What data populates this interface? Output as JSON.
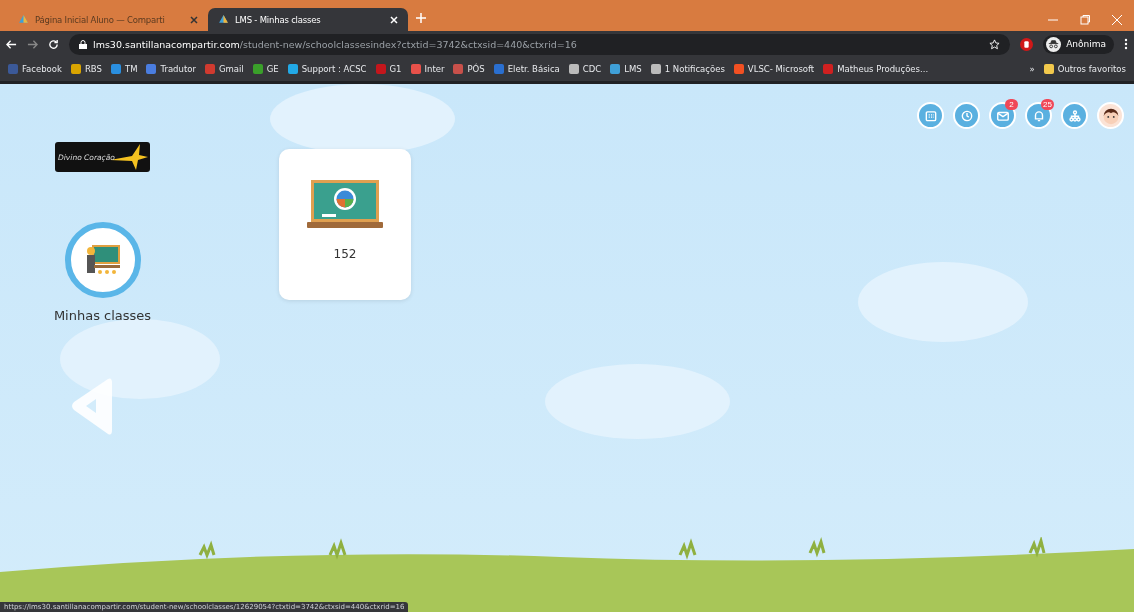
{
  "browser": {
    "tabs": [
      {
        "title": "Página Inicial Aluno — Comparti",
        "selected": false
      },
      {
        "title": "LMS - Minhas classes",
        "selected": true
      }
    ],
    "url_host": "lms30.santillanacompartir.com",
    "url_path": "/student-new/schoolclassesindex?ctxtid=3742&ctxsid=440&ctxrid=16",
    "profile": "Anônima",
    "bookmarks": [
      {
        "label": "Facebook",
        "color": "#3b5998"
      },
      {
        "label": "RBS",
        "color": "#d9a400"
      },
      {
        "label": "TM",
        "color": "#2a8fe0"
      },
      {
        "label": "Tradutor",
        "color": "#4a7de0"
      },
      {
        "label": "Gmail",
        "color": "#d03a2f"
      },
      {
        "label": "GE",
        "color": "#3aa02a"
      },
      {
        "label": "Support : ACSC",
        "color": "#22a9e6"
      },
      {
        "label": "G1",
        "color": "#c4161c"
      },
      {
        "label": "Inter",
        "color": "#e8514a"
      },
      {
        "label": "PÓS",
        "color": "#c8504a"
      },
      {
        "label": "Eletr. Básica",
        "color": "#2a6fd0"
      },
      {
        "label": "CDC",
        "color": "#bbbbbb"
      },
      {
        "label": "LMS",
        "color": "#3fa0d8"
      },
      {
        "label": "1 Notificações",
        "color": "#bbbbbb"
      },
      {
        "label": "VLSC- Microsoft",
        "color": "#f25022"
      },
      {
        "label": "Matheus Produções...",
        "color": "#d02020"
      }
    ],
    "overflow": "»",
    "other_bookmarks": "Outros favoritos"
  },
  "page": {
    "logo_text": "Divino Coração",
    "nav_item": {
      "label": "Minhas classes"
    },
    "classes": [
      {
        "name": "152"
      }
    ],
    "header_icons": [
      {
        "kind": "calendar"
      },
      {
        "kind": "clock"
      },
      {
        "kind": "mail",
        "badge": "2"
      },
      {
        "kind": "bell",
        "badge": "25"
      },
      {
        "kind": "network"
      },
      {
        "kind": "avatar"
      }
    ]
  },
  "status_url": "https://lms30.santillanacompartir.com/student-new/schoolclasses/12629054?ctxtid=3742&ctxsid=440&ctxrid=16"
}
